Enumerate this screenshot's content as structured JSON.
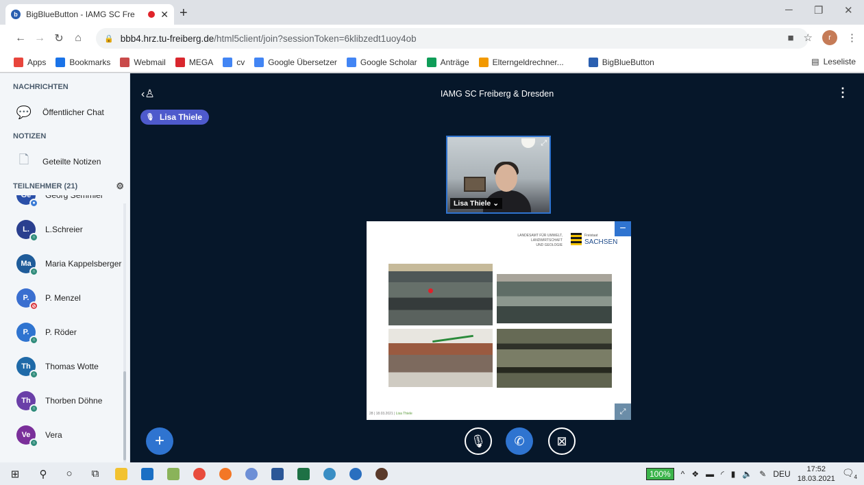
{
  "browser": {
    "tab_title": "BigBlueButton - IAMG SC Fre",
    "url_host": "bbb4.hrz.tu-freiberg.de",
    "url_path": "/html5client/join?sessionToken=6klibzedt1uoy4ob",
    "profile_initial": "r",
    "bookmarks": [
      {
        "label": "Apps",
        "icon": "apps-icon",
        "color": "#e8453c"
      },
      {
        "label": "Bookmarks",
        "icon": "star-icon",
        "color": "#1a73e8"
      },
      {
        "label": "Webmail",
        "icon": "mail-icon",
        "color": "#c94a4a"
      },
      {
        "label": "MEGA",
        "icon": "mega-icon",
        "color": "#d9272e"
      },
      {
        "label": "cv",
        "icon": "doc-icon",
        "color": "#4285f4"
      },
      {
        "label": "Google Übersetzer",
        "icon": "translate-icon",
        "color": "#4285f4"
      },
      {
        "label": "Google Scholar",
        "icon": "scholar-icon",
        "color": "#4285f4"
      },
      {
        "label": "Anträge",
        "icon": "plus-box-icon",
        "color": "#0f9d58"
      },
      {
        "label": "Elterngeldrechner...",
        "icon": "elterngeld-icon",
        "color": "#f29900"
      },
      {
        "label": "BigBlueButton",
        "icon": "bbb-icon",
        "color": "#2a5fb0"
      }
    ],
    "reading_list": "Leseliste"
  },
  "sidebar": {
    "messages_header": "NACHRICHTEN",
    "public_chat": "Öffentlicher Chat",
    "notes_header": "NOTIZEN",
    "shared_notes": "Geteilte Notizen",
    "participants_header": "TEILNEHMER (21)",
    "users": [
      {
        "initials": "Ge",
        "name": "Georg Semmler",
        "color": "#2a4fa8",
        "status": "mic",
        "status_color": "#3a7bd5"
      },
      {
        "initials": "L.",
        "name": "L.Schreier",
        "color": "#2a3f8f",
        "status": "listen",
        "status_color": "#2e8b7a"
      },
      {
        "initials": "Ma",
        "name": "Maria Kappelsberger",
        "color": "#1f5c9a",
        "status": "listen",
        "status_color": "#2e8b7a"
      },
      {
        "initials": "P.",
        "name": "P. Menzel",
        "color": "#3a6fd0",
        "status": "muted",
        "status_color": "#d9363e"
      },
      {
        "initials": "P.",
        "name": "P. Röder",
        "color": "#2f74d0",
        "status": "listen",
        "status_color": "#2e8b7a"
      },
      {
        "initials": "Th",
        "name": "Thomas Wotte",
        "color": "#1f6aa8",
        "status": "listen",
        "status_color": "#2e8b7a"
      },
      {
        "initials": "Th",
        "name": "Thorben Döhne",
        "color": "#6a3fa8",
        "status": "listen",
        "status_color": "#2e8b7a"
      },
      {
        "initials": "Ve",
        "name": "Vera",
        "color": "#7a2f9a",
        "status": "listen",
        "status_color": "#2e8b7a"
      }
    ]
  },
  "main": {
    "meeting_title": "IAMG SC Freiberg & Dresden",
    "talking_user": "Lisa Thiele",
    "webcam_name": "Lisa Thiele",
    "slide": {
      "agency_line1": "LANDESAMT FÜR UMWELT,",
      "agency_line2": "LANDWIRTSCHAFT",
      "agency_line3": "UND GEOLOGIE",
      "state_small": "Freistaat",
      "state_name": "SACHSEN",
      "footer": "28 | 18.03.2021 |",
      "footer_author": "Lisa Thiele"
    }
  },
  "taskbar": {
    "battery": "100%",
    "language": "DEU",
    "time": "17:52",
    "date": "18.03.2021",
    "notifications": "4"
  }
}
